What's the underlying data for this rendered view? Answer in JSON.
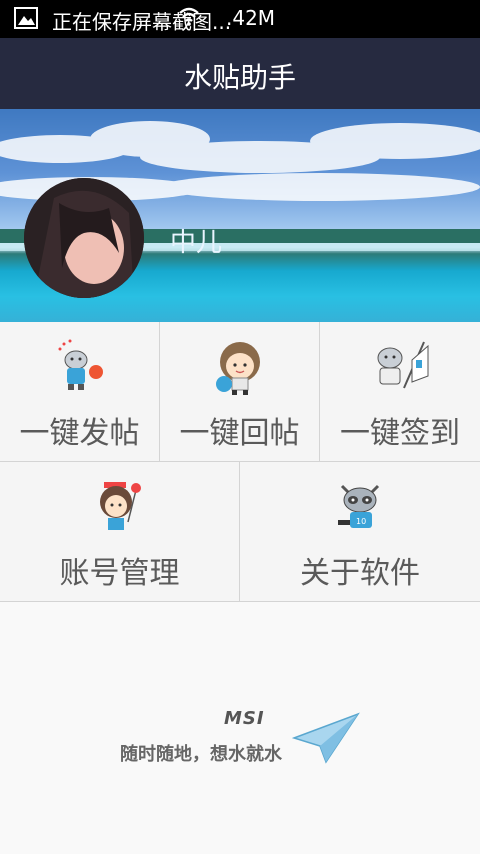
{
  "status_bar": {
    "notification_text": "正在保存屏幕截图...",
    "size_text": ".42M"
  },
  "app": {
    "title": "水贴助手"
  },
  "profile": {
    "username": "中儿"
  },
  "menu": [
    {
      "label": "一键发帖",
      "icon": "cat-mascot-icon"
    },
    {
      "label": "一键回帖",
      "icon": "girl-mascot-icon"
    },
    {
      "label": "一键签到",
      "icon": "flag-mascot-icon"
    },
    {
      "label": "账号管理",
      "icon": "girl-flower-icon"
    },
    {
      "label": "关于软件",
      "icon": "raccoon-mascot-icon"
    }
  ],
  "footer": {
    "brand": "MSI",
    "slogan": "随时随地，想水就水"
  },
  "colors": {
    "title_bar": "#262a40",
    "status_bar": "#000000",
    "grid_bg": "#f5f5f5",
    "grid_line": "#d4d4d4"
  }
}
